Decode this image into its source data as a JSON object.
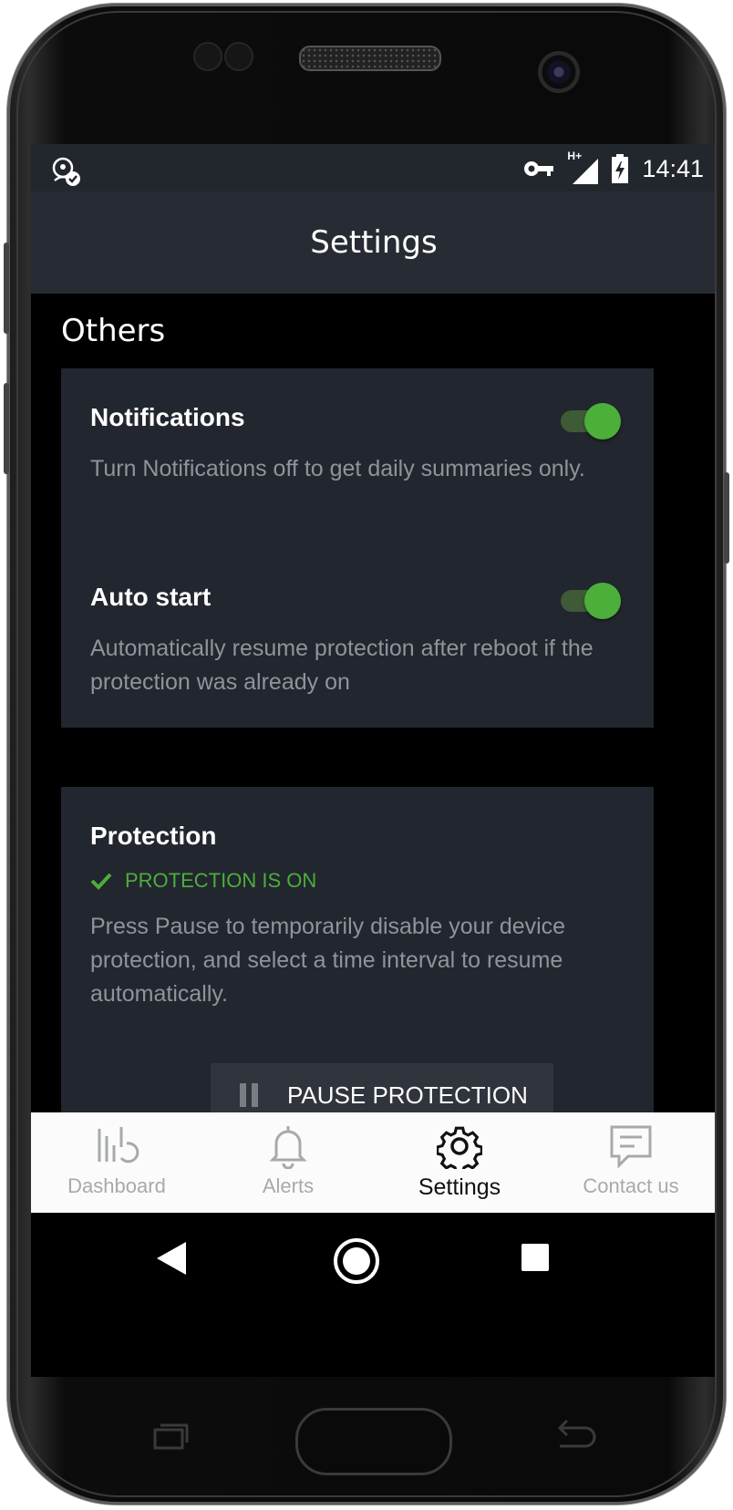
{
  "status_bar": {
    "time": "14:41",
    "network_label": "H+",
    "icons": [
      "privacy-app-icon",
      "vpn-key-icon",
      "signal-icon",
      "battery-charging-icon"
    ]
  },
  "app_bar": {
    "title": "Settings"
  },
  "others_section": {
    "label": "Others",
    "items": [
      {
        "title": "Notifications",
        "description": "Turn Notifications off to get daily summaries only.",
        "enabled": true
      },
      {
        "title": "Auto start",
        "description": "Automatically resume protection after reboot if the protection was already on",
        "enabled": true
      }
    ]
  },
  "protection_section": {
    "title": "Protection",
    "status": "PROTECTION IS ON",
    "status_color": "#4cae3c",
    "description": "Press Pause to temporarily disable your device protection, and select a time interval to resume automatically.",
    "pause_button_label": "PAUSE PROTECTION"
  },
  "bottom_nav": {
    "items": [
      {
        "label": "Dashboard",
        "icon": "dashboard-icon",
        "active": false
      },
      {
        "label": "Alerts",
        "icon": "bell-icon",
        "active": false
      },
      {
        "label": "Settings",
        "icon": "gear-icon",
        "active": true
      },
      {
        "label": "Contact us",
        "icon": "chat-icon",
        "active": false
      }
    ]
  },
  "colors": {
    "accent": "#4caf3a",
    "card_background": "#22262e",
    "app_bar_background": "#272b33"
  }
}
